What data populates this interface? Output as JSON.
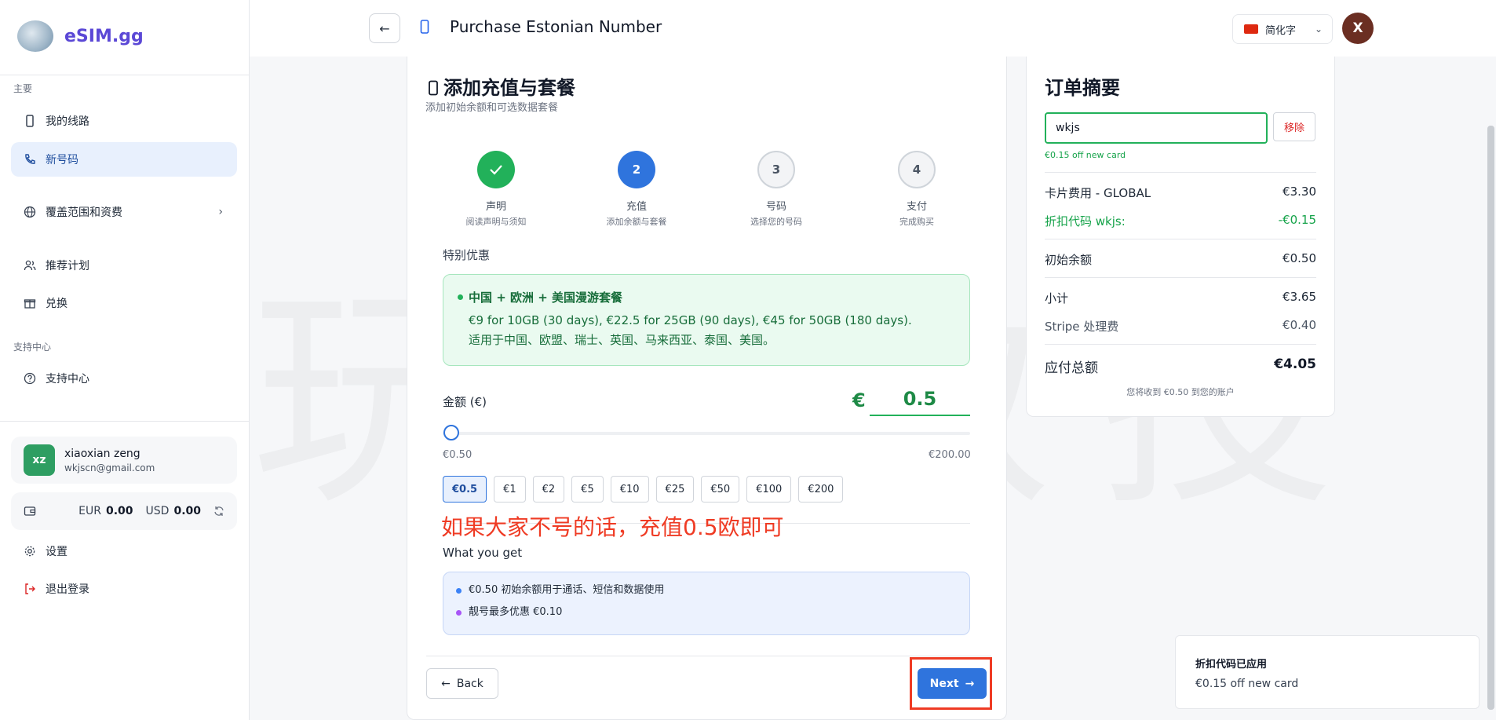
{
  "brand": {
    "name": "eSIM.gg"
  },
  "sidebar": {
    "section_main": "主要",
    "items": [
      {
        "label": "我的线路",
        "icon": "phone-icon"
      },
      {
        "label": "新号码",
        "icon": "phone-call-icon"
      },
      {
        "label": "覆盖范围和资费",
        "icon": "globe-icon"
      },
      {
        "label": "推荐计划",
        "icon": "users-icon"
      },
      {
        "label": "兑换",
        "icon": "gift-icon"
      }
    ],
    "section_support": "支持中心",
    "support_item": {
      "label": "支持中心",
      "icon": "help-circle-icon"
    },
    "user": {
      "initials": "xz",
      "name": "xiaoxian zeng",
      "email": "wkjscn@gmail.com"
    },
    "wallet": {
      "eur_label": "EUR",
      "eur_value": "0.00",
      "usd_label": "USD",
      "usd_value": "0.00"
    },
    "settings_label": "设置",
    "logout_label": "退出登录"
  },
  "header": {
    "title": "Purchase Estonian Number",
    "language": "简化字",
    "avatar_initial": "X"
  },
  "main": {
    "title": "添加充值与套餐",
    "subtitle": "添加初始余额和可选数据套餐",
    "steps": [
      {
        "number": "",
        "title": "声明",
        "desc": "阅读声明与须知",
        "state": "done"
      },
      {
        "number": "2",
        "title": "充值",
        "desc": "添加余额与套餐",
        "state": "current"
      },
      {
        "number": "3",
        "title": "号码",
        "desc": "选择您的号码",
        "state": "todo"
      },
      {
        "number": "4",
        "title": "支付",
        "desc": "完成购买",
        "state": "todo"
      }
    ],
    "special_label": "特别优惠",
    "promo": {
      "title": "中国 + 欧洲 + 美国漫游套餐",
      "line1": "€9 for 10GB (30 days), €22.5 for 25GB (90 days), €45 for 50GB (180 days).",
      "line2": "适用于中国、欧盟、瑞士、英国、马来西亚、泰国、美国。"
    },
    "amount": {
      "label": "金额 (€)",
      "currency": "€",
      "value": "0.5",
      "min_label": "€0.50",
      "max_label": "€200.00",
      "slider_level": 0
    },
    "quick_amounts": [
      "€0.5",
      "€1",
      "€2",
      "€5",
      "€10",
      "€25",
      "€50",
      "€100",
      "€200"
    ],
    "selected_amount": "€0.5",
    "annotation": "如果大家不号的话，充值0.5欧即可",
    "what_you_get_label": "What you get",
    "what_you_get": [
      {
        "text": "€0.50 初始余额用于通话、短信和数据使用",
        "color": "#3b82f6"
      },
      {
        "text": "靓号最多优惠 €0.10",
        "color": "#a855f7"
      }
    ],
    "back_label": "Back",
    "next_label": "Next"
  },
  "summary": {
    "title": "订单摘要",
    "coupon_value": "wkjs",
    "remove_label": "移除",
    "coupon_note": "€0.15 off new card",
    "rows": {
      "card_fee": {
        "label": "卡片费用 - GLOBAL",
        "value": "€3.30"
      },
      "discount": {
        "label": "折扣代码 wkjs:",
        "value": "-€0.15"
      },
      "initial_balance": {
        "label": "初始余额",
        "value": "€0.50"
      },
      "subtotal": {
        "label": "小计",
        "value": "€3.65"
      },
      "stripe_fee": {
        "label": "Stripe 处理费",
        "value": "€0.40"
      },
      "total": {
        "label": "应付总额",
        "value": "€4.05"
      }
    },
    "footnote": "您将收到 €0.50 到您的账户"
  },
  "toast": {
    "title": "折扣代码已应用",
    "message": "€0.15 off new card"
  },
  "colors": {
    "accent": "#2f74dd",
    "success": "#22b15a",
    "brand": "#5b48d6",
    "annotation": "#ef3b24"
  }
}
